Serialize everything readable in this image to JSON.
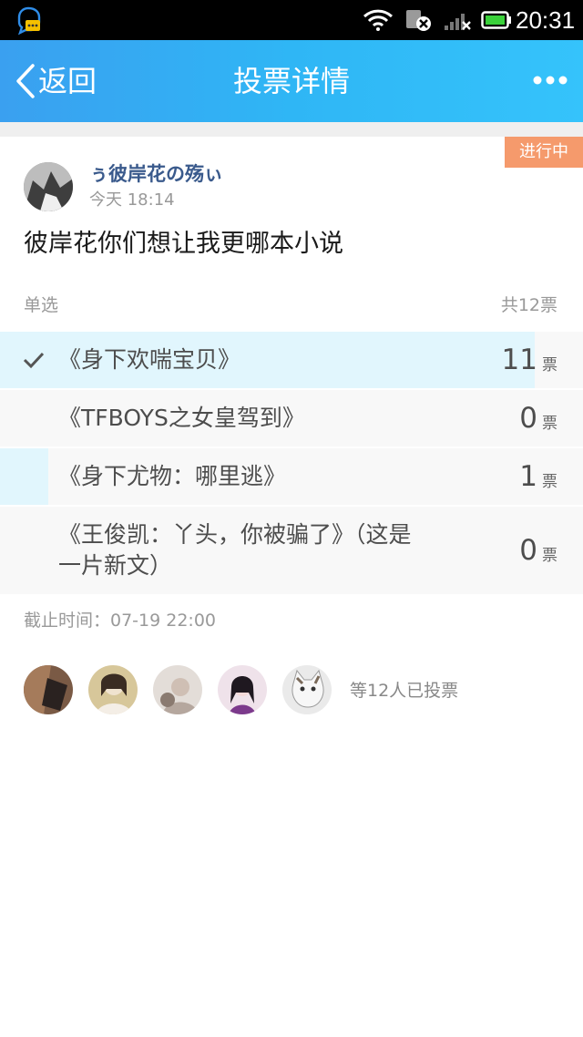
{
  "status_bar": {
    "time": "20:31",
    "icons": [
      "qq-notification-icon",
      "wifi-icon",
      "sim-error-icon",
      "signal-icon",
      "battery-icon"
    ]
  },
  "title_bar": {
    "back_label": "返回",
    "title": "投票详情",
    "more_icon": "more-dots-icon"
  },
  "post": {
    "status_badge": "进行中",
    "author": "ぅ彼岸花の殇ぃ",
    "time": "今天 18:14",
    "question": "彼岸花你们想让我更哪本小说"
  },
  "vote": {
    "type": "单选",
    "total": "共12票",
    "unit": "票",
    "options": [
      {
        "label": "《身下欢喘宝贝》",
        "count": "11",
        "share": 0.9167,
        "selected": true
      },
      {
        "label": "《TFBOYS之女皇驾到》",
        "count": "0",
        "share": 0,
        "selected": false
      },
      {
        "label": "《身下尤物：哪里逃》",
        "count": "1",
        "share": 0.0833,
        "selected": false
      },
      {
        "label_line1": "《王俊凯：丫头，你被骗了》（这是",
        "label_line2": "一片新文）",
        "count": "0",
        "share": 0,
        "selected": false
      }
    ],
    "deadline": "截止时间：07-19 22:00"
  },
  "voters": {
    "summary": "等12人已投票",
    "avatar_count": 5
  },
  "colors": {
    "accent_blue": "#2fb6f5",
    "badge_orange": "#f59a6c",
    "bar_fill": "#e1f6fd",
    "author_blue": "#3a5a8c"
  }
}
